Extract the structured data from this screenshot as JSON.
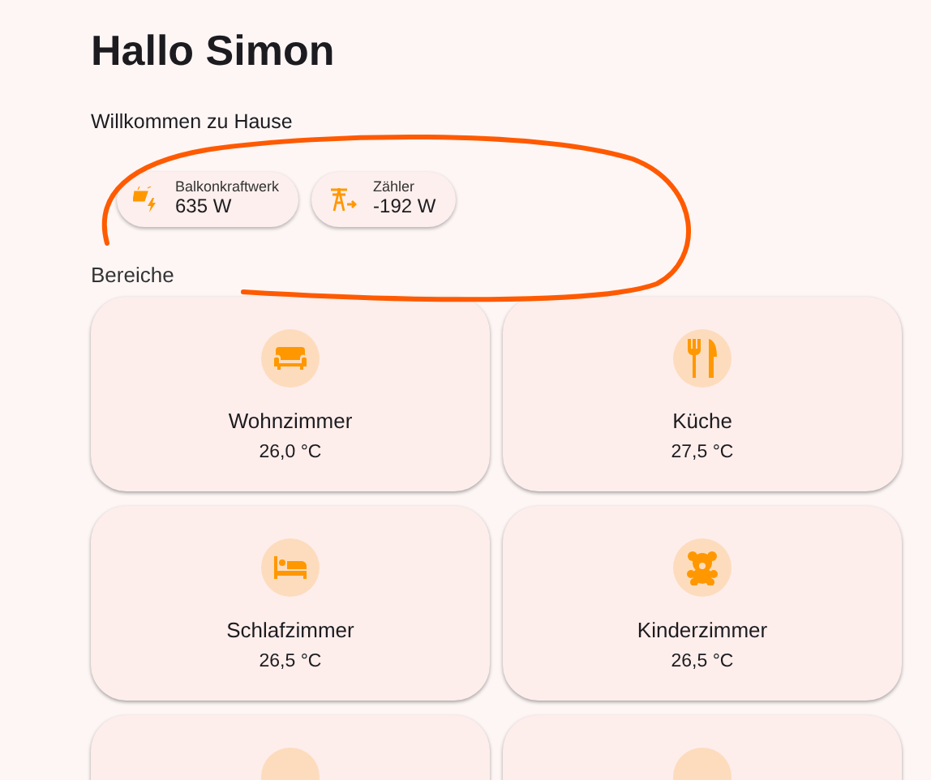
{
  "title": "Hallo Simon",
  "subtitle": "Willkommen zu Hause",
  "chips": [
    {
      "label": "Balkonkraftwerk",
      "value": "635 W"
    },
    {
      "label": "Zähler",
      "value": "-192 W"
    }
  ],
  "section_title": "Bereiche",
  "areas": [
    {
      "kind": "room",
      "name": "Wohnzimmer",
      "temperature": "26,0 °C"
    },
    {
      "kind": "room",
      "name": "Küche",
      "temperature": "27,5 °C"
    },
    {
      "kind": "room",
      "name": "Schlafzimmer",
      "temperature": "26,5 °C"
    },
    {
      "kind": "room",
      "name": "Kinderzimmer",
      "temperature": "26,5 °C"
    },
    {
      "kind": "cut-off"
    },
    {
      "kind": "cut-off"
    }
  ]
}
